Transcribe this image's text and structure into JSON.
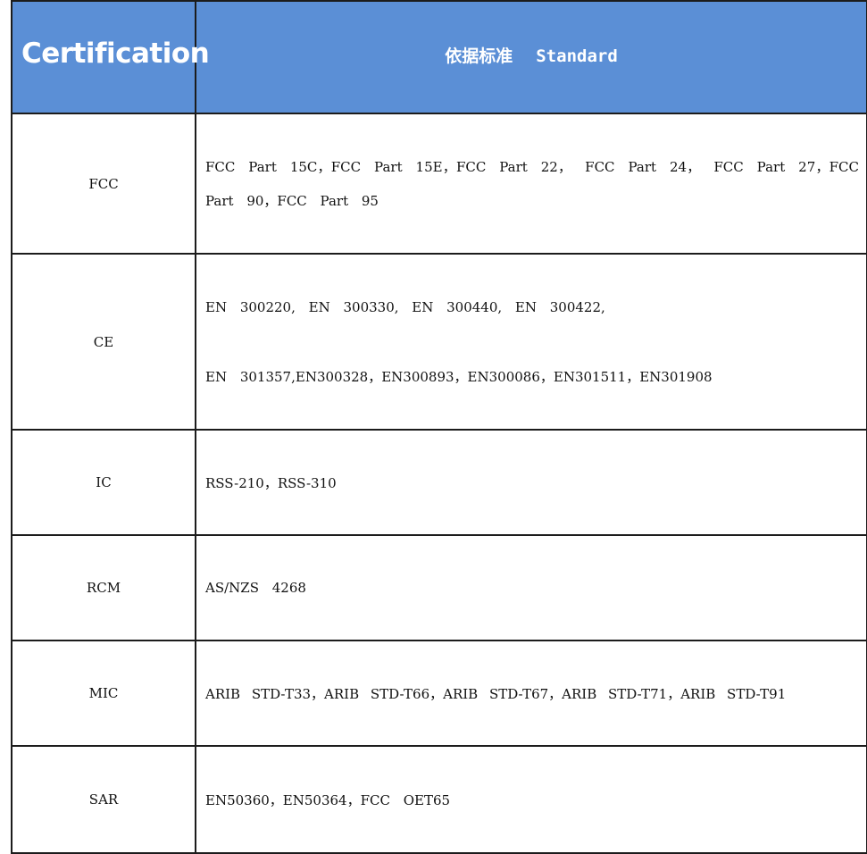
{
  "header": {
    "certification": "Certification",
    "standard_cn": "依据标准",
    "standard_en": "Standard"
  },
  "rows": [
    {
      "name": "FCC",
      "lines": [
        "FCC Part 15C，FCC Part 15E，FCC Part 22， FCC Part 24， FCC Part 27，FCC Part 90，FCC Part 95"
      ]
    },
    {
      "name": "CE",
      "lines": [
        "EN 300220, EN 300330, EN 300440, EN 300422,",
        "EN 301357,EN300328，EN300893，EN300086，EN301511，EN301908"
      ]
    },
    {
      "name": "IC",
      "lines": [
        "RSS-210，RSS-310"
      ]
    },
    {
      "name": "RCM",
      "lines": [
        "AS/NZS 4268"
      ]
    },
    {
      "name": "MIC",
      "lines": [
        "ARIB STD-T33，ARIB STD-T66，ARIB STD-T67，ARIB STD-T71，ARIB STD-T91"
      ]
    },
    {
      "name": "SAR",
      "lines": [
        "EN50360，EN50364，FCC OET65"
      ]
    }
  ]
}
